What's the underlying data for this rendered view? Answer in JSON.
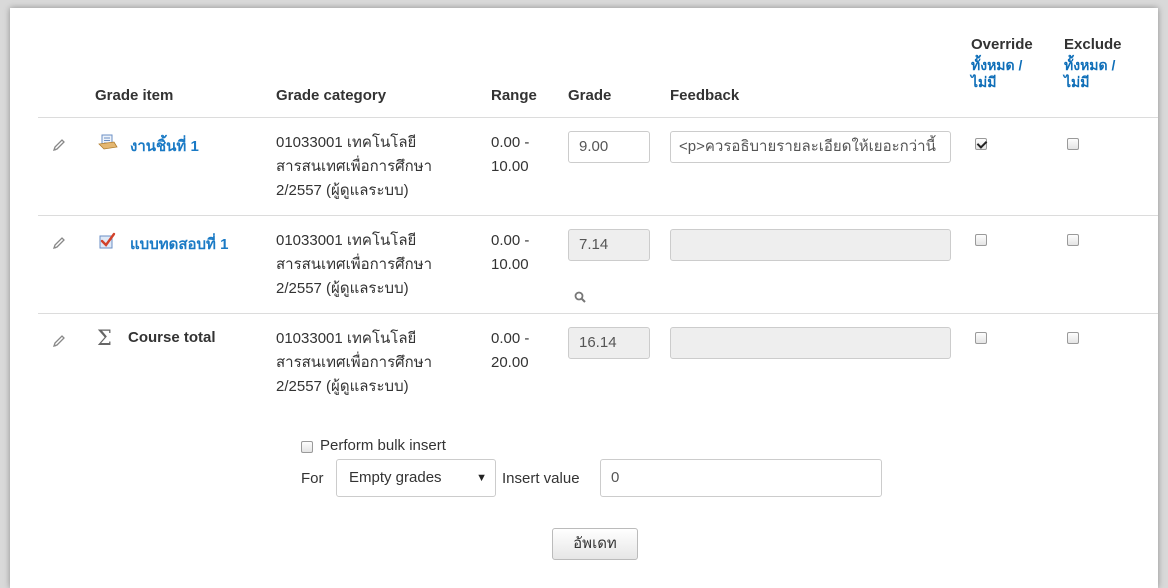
{
  "headers": {
    "grade_item": "Grade item",
    "grade_category": "Grade category",
    "range": "Range",
    "grade": "Grade",
    "feedback": "Feedback",
    "override": "Override",
    "override_all": "ทั้งหมด /",
    "override_none": "ไม่มี",
    "exclude": "Exclude",
    "exclude_all": "ทั้งหมด /",
    "exclude_none": "ไม่มี"
  },
  "rows": [
    {
      "item": "งานชิ้นที่ 1",
      "item_icon": "assignment-icon",
      "category_lines": [
        "01033001 เทคโนโลยี",
        "สารสนเทศเพื่อการศึกษา",
        "2/2557 (ผู้ดูแลระบบ)"
      ],
      "range_lines": [
        "0.00 -",
        "10.00"
      ],
      "grade": "9.00",
      "feedback": "<p>ควรอธิบายรายละเอียดให้เยอะกว่านี้",
      "override": true,
      "exclude": false
    },
    {
      "item": "แบบทดสอบที่ 1",
      "item_icon": "quiz-icon",
      "category_lines": [
        "01033001 เทคโนโลยี",
        "สารสนเทศเพื่อการศึกษา",
        "2/2557 (ผู้ดูแลระบบ)"
      ],
      "range_lines": [
        "0.00 -",
        "10.00"
      ],
      "grade": "7.14",
      "feedback": "",
      "override": false,
      "exclude": false
    },
    {
      "item": "Course total",
      "item_icon": "sigma-icon",
      "category_lines": [
        "01033001 เทคโนโลยี",
        "สารสนเทศเพื่อการศึกษา",
        "2/2557 (ผู้ดูแลระบบ)"
      ],
      "range_lines": [
        "0.00 -",
        "20.00"
      ],
      "grade": "16.14",
      "feedback": "",
      "override": false,
      "exclude": false
    }
  ],
  "bulk": {
    "checkbox_label": "Perform bulk insert",
    "for_label": "For",
    "for_value": "Empty grades",
    "insert_label": "Insert value",
    "insert_value": "0"
  },
  "update_button": "อัพเดท",
  "colors": {
    "link": "#1a7ac5",
    "border": "#dcdcdc",
    "disabled_bg": "#eeeeee"
  }
}
